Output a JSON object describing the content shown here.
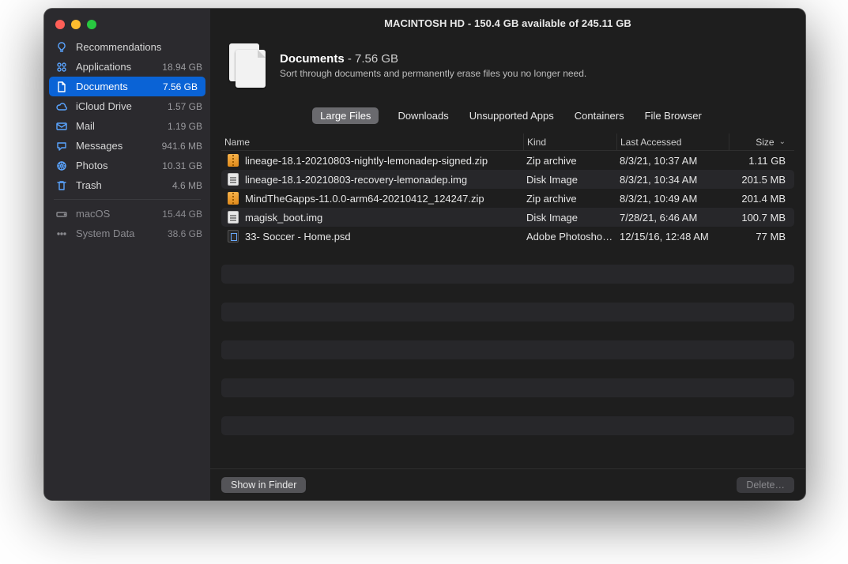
{
  "titlebar": "MACINTOSH HD - 150.4 GB available of 245.11 GB",
  "sidebar": {
    "items": [
      {
        "icon": "bulb",
        "label": "Recommendations",
        "value": ""
      },
      {
        "icon": "apps",
        "label": "Applications",
        "value": "18.94 GB"
      },
      {
        "icon": "doc",
        "label": "Documents",
        "value": "7.56 GB",
        "selected": true
      },
      {
        "icon": "cloud",
        "label": "iCloud Drive",
        "value": "1.57 GB"
      },
      {
        "icon": "mail",
        "label": "Mail",
        "value": "1.19 GB"
      },
      {
        "icon": "msg",
        "label": "Messages",
        "value": "941.6 MB"
      },
      {
        "icon": "photos",
        "label": "Photos",
        "value": "10.31 GB"
      },
      {
        "icon": "trash",
        "label": "Trash",
        "value": "4.6 MB"
      }
    ],
    "system": [
      {
        "icon": "disk",
        "label": "macOS",
        "value": "15.44 GB"
      },
      {
        "icon": "dots",
        "label": "System Data",
        "value": "38.6 GB"
      }
    ]
  },
  "header": {
    "title": "Documents",
    "size": " - 7.56 GB",
    "subtitle": "Sort through documents and permanently erase files you no longer need."
  },
  "tabs": [
    "Large Files",
    "Downloads",
    "Unsupported Apps",
    "Containers",
    "File Browser"
  ],
  "active_tab": 0,
  "columns": {
    "name": "Name",
    "kind": "Kind",
    "accessed": "Last Accessed",
    "size": "Size"
  },
  "files": [
    {
      "icon": "zip",
      "name": "lineage-18.1-20210803-nightly-lemonadep-signed.zip",
      "kind": "Zip archive",
      "accessed": "8/3/21, 10:37 AM",
      "size": "1.11 GB"
    },
    {
      "icon": "img",
      "name": "lineage-18.1-20210803-recovery-lemonadep.img",
      "kind": "Disk Image",
      "accessed": "8/3/21, 10:34 AM",
      "size": "201.5 MB"
    },
    {
      "icon": "zip",
      "name": "MindTheGapps-11.0.0-arm64-20210412_124247.zip",
      "kind": "Zip archive",
      "accessed": "8/3/21, 10:49 AM",
      "size": "201.4 MB"
    },
    {
      "icon": "img",
      "name": "magisk_boot.img",
      "kind": "Disk Image",
      "accessed": "7/28/21, 6:46 AM",
      "size": "100.7 MB"
    },
    {
      "icon": "psd",
      "name": "33- Soccer - Home.psd",
      "kind": "Adobe Photosho…",
      "accessed": "12/15/16, 12:48 AM",
      "size": "77 MB"
    }
  ],
  "footer": {
    "show_in_finder": "Show in Finder",
    "delete": "Delete…"
  }
}
